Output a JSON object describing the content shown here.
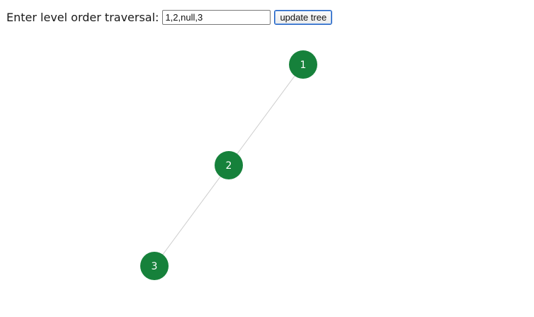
{
  "form": {
    "label": "Enter level order traversal:",
    "input_value": "1,2,null,3",
    "button_label": "update tree"
  },
  "tree": {
    "node_color": "#16813b",
    "edge_color": "#cccccc",
    "nodes": [
      {
        "value": "1",
        "level": 0
      },
      {
        "value": "2",
        "level": 1,
        "parent": 0,
        "side": "left"
      },
      {
        "value": "3",
        "level": 2,
        "parent": 1,
        "side": "left"
      }
    ]
  }
}
